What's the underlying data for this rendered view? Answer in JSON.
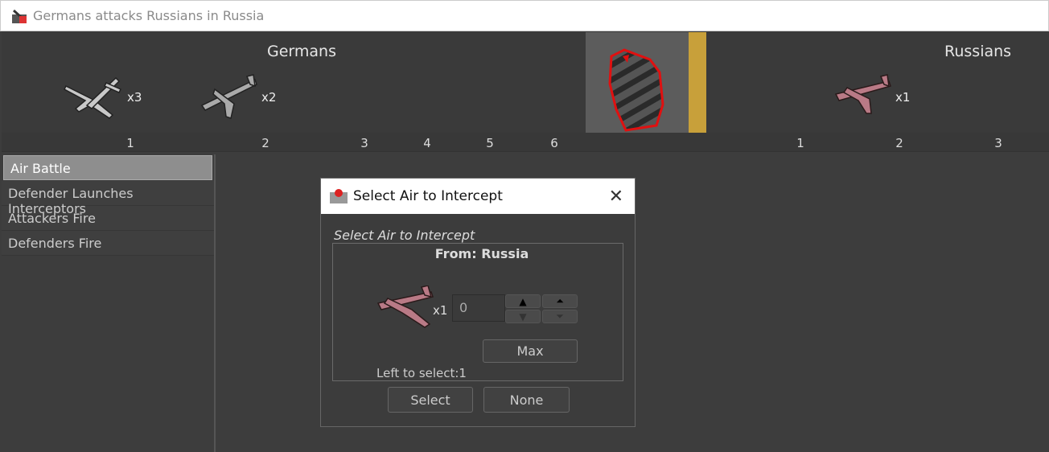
{
  "window": {
    "title": "Germans attacks Russians in Russia"
  },
  "battle": {
    "attacker": {
      "name": "Germans",
      "units": [
        {
          "icon": "bomber-plane-icon",
          "count": "x3"
        },
        {
          "icon": "fighter-plane-icon",
          "count": "x2"
        }
      ],
      "columns": [
        "1",
        "2",
        "3",
        "4",
        "5",
        "6"
      ]
    },
    "defender": {
      "name": "Russians",
      "units": [
        {
          "icon": "russian-fighter-plane-icon",
          "count": "x1"
        }
      ],
      "columns": [
        "1",
        "2",
        "3"
      ]
    }
  },
  "steps": [
    {
      "label": "Air Battle",
      "active": true
    },
    {
      "label": "Defender Launches Interceptors"
    },
    {
      "label": "Attackers Fire"
    },
    {
      "label": "Defenders Fire"
    }
  ],
  "dialog": {
    "title": "Select Air to Intercept",
    "group_label": "Select Air to Intercept",
    "from": "From: Russia",
    "unit_count": "x1",
    "value": "0",
    "max": "Max",
    "left": "Left to select:1",
    "select": "Select",
    "none": "None"
  },
  "colors": {
    "background": "#3d3d3d",
    "territory_outline": "#e01010"
  }
}
